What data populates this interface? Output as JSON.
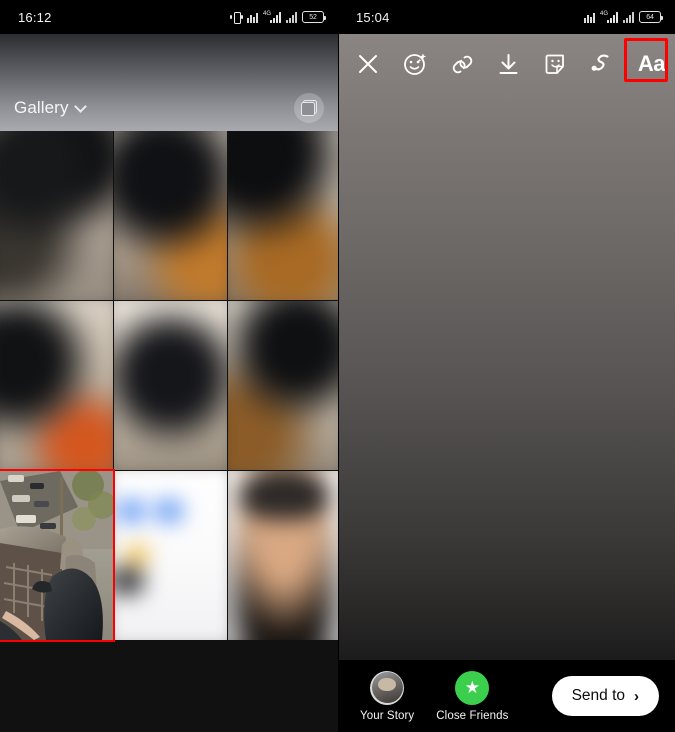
{
  "left_panel": {
    "status": {
      "time": "16:12",
      "icons": [
        "vibrate-icon",
        "sim-signal-icon",
        "network-4g-icon",
        "signal-bars-icon",
        "battery-icon"
      ],
      "network_label": "4G",
      "battery_level": "52"
    },
    "header": {
      "title": "Gallery",
      "chevron": "chevron-down-icon",
      "multiselect_button": "multi-select-icon"
    },
    "gallery": {
      "columns": 3,
      "items": [
        {
          "id": "photo-1",
          "selected": false,
          "blurred": true
        },
        {
          "id": "photo-2",
          "selected": false,
          "blurred": true
        },
        {
          "id": "photo-3",
          "selected": false,
          "blurred": true
        },
        {
          "id": "photo-4",
          "selected": false,
          "blurred": true
        },
        {
          "id": "photo-5",
          "selected": false,
          "blurred": true
        },
        {
          "id": "photo-6",
          "selected": false,
          "blurred": true
        },
        {
          "id": "photo-7",
          "selected": true,
          "blurred": false
        },
        {
          "id": "photo-8",
          "selected": false,
          "blurred": true
        },
        {
          "id": "photo-9",
          "selected": false,
          "blurred": true
        }
      ],
      "selection_color": "#ff0000"
    }
  },
  "right_panel": {
    "status": {
      "time": "15:04",
      "icons": [
        "sim-signal-icon",
        "network-4g-icon",
        "signal-bars-icon",
        "battery-icon"
      ],
      "network_label": "4G",
      "battery_level": "64"
    },
    "toolbar": {
      "items": [
        {
          "name": "close-icon",
          "label": "Close"
        },
        {
          "name": "effects-icon",
          "label": "Effects"
        },
        {
          "name": "link-icon",
          "label": "Link"
        },
        {
          "name": "download-icon",
          "label": "Save"
        },
        {
          "name": "sticker-icon",
          "label": "Sticker"
        },
        {
          "name": "draw-icon",
          "label": "Draw"
        },
        {
          "name": "text-icon",
          "label": "Aa"
        }
      ],
      "highlighted": "text-icon",
      "highlight_color": "#ff0000"
    },
    "bottom": {
      "your_story_label": "Your Story",
      "close_friends_label": "Close Friends",
      "send_label": "Send to",
      "send_chevron": "›",
      "close_friends_color": "#3ccf4e"
    }
  }
}
